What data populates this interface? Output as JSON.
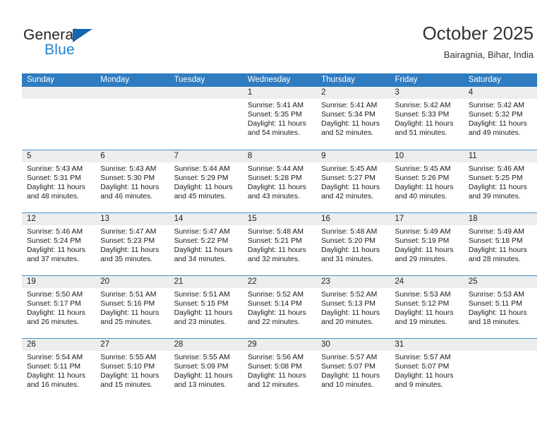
{
  "brand": {
    "name_top": "General",
    "name_bottom": "Blue",
    "accent_color": "#2283d1",
    "triangle_color": "#1666b0"
  },
  "header": {
    "title": "October 2025",
    "subtitle": "Bairagnia, Bihar, India"
  },
  "calendar": {
    "header_color": "#2f7cc0",
    "daynum_band_color": "#ededed",
    "row_divider_color": "#4a90c8",
    "day_names": [
      "Sunday",
      "Monday",
      "Tuesday",
      "Wednesday",
      "Thursday",
      "Friday",
      "Saturday"
    ],
    "weeks": [
      [
        {
          "day": "",
          "empty": true
        },
        {
          "day": "",
          "empty": true
        },
        {
          "day": "",
          "empty": true
        },
        {
          "day": "1",
          "sunrise": "Sunrise: 5:41 AM",
          "sunset": "Sunset: 5:35 PM",
          "daylight_line1": "Daylight: 11 hours",
          "daylight_line2": "and 54 minutes."
        },
        {
          "day": "2",
          "sunrise": "Sunrise: 5:41 AM",
          "sunset": "Sunset: 5:34 PM",
          "daylight_line1": "Daylight: 11 hours",
          "daylight_line2": "and 52 minutes."
        },
        {
          "day": "3",
          "sunrise": "Sunrise: 5:42 AM",
          "sunset": "Sunset: 5:33 PM",
          "daylight_line1": "Daylight: 11 hours",
          "daylight_line2": "and 51 minutes."
        },
        {
          "day": "4",
          "sunrise": "Sunrise: 5:42 AM",
          "sunset": "Sunset: 5:32 PM",
          "daylight_line1": "Daylight: 11 hours",
          "daylight_line2": "and 49 minutes."
        }
      ],
      [
        {
          "day": "5",
          "sunrise": "Sunrise: 5:43 AM",
          "sunset": "Sunset: 5:31 PM",
          "daylight_line1": "Daylight: 11 hours",
          "daylight_line2": "and 48 minutes."
        },
        {
          "day": "6",
          "sunrise": "Sunrise: 5:43 AM",
          "sunset": "Sunset: 5:30 PM",
          "daylight_line1": "Daylight: 11 hours",
          "daylight_line2": "and 46 minutes."
        },
        {
          "day": "7",
          "sunrise": "Sunrise: 5:44 AM",
          "sunset": "Sunset: 5:29 PM",
          "daylight_line1": "Daylight: 11 hours",
          "daylight_line2": "and 45 minutes."
        },
        {
          "day": "8",
          "sunrise": "Sunrise: 5:44 AM",
          "sunset": "Sunset: 5:28 PM",
          "daylight_line1": "Daylight: 11 hours",
          "daylight_line2": "and 43 minutes."
        },
        {
          "day": "9",
          "sunrise": "Sunrise: 5:45 AM",
          "sunset": "Sunset: 5:27 PM",
          "daylight_line1": "Daylight: 11 hours",
          "daylight_line2": "and 42 minutes."
        },
        {
          "day": "10",
          "sunrise": "Sunrise: 5:45 AM",
          "sunset": "Sunset: 5:26 PM",
          "daylight_line1": "Daylight: 11 hours",
          "daylight_line2": "and 40 minutes."
        },
        {
          "day": "11",
          "sunrise": "Sunrise: 5:46 AM",
          "sunset": "Sunset: 5:25 PM",
          "daylight_line1": "Daylight: 11 hours",
          "daylight_line2": "and 39 minutes."
        }
      ],
      [
        {
          "day": "12",
          "sunrise": "Sunrise: 5:46 AM",
          "sunset": "Sunset: 5:24 PM",
          "daylight_line1": "Daylight: 11 hours",
          "daylight_line2": "and 37 minutes."
        },
        {
          "day": "13",
          "sunrise": "Sunrise: 5:47 AM",
          "sunset": "Sunset: 5:23 PM",
          "daylight_line1": "Daylight: 11 hours",
          "daylight_line2": "and 35 minutes."
        },
        {
          "day": "14",
          "sunrise": "Sunrise: 5:47 AM",
          "sunset": "Sunset: 5:22 PM",
          "daylight_line1": "Daylight: 11 hours",
          "daylight_line2": "and 34 minutes."
        },
        {
          "day": "15",
          "sunrise": "Sunrise: 5:48 AM",
          "sunset": "Sunset: 5:21 PM",
          "daylight_line1": "Daylight: 11 hours",
          "daylight_line2": "and 32 minutes."
        },
        {
          "day": "16",
          "sunrise": "Sunrise: 5:48 AM",
          "sunset": "Sunset: 5:20 PM",
          "daylight_line1": "Daylight: 11 hours",
          "daylight_line2": "and 31 minutes."
        },
        {
          "day": "17",
          "sunrise": "Sunrise: 5:49 AM",
          "sunset": "Sunset: 5:19 PM",
          "daylight_line1": "Daylight: 11 hours",
          "daylight_line2": "and 29 minutes."
        },
        {
          "day": "18",
          "sunrise": "Sunrise: 5:49 AM",
          "sunset": "Sunset: 5:18 PM",
          "daylight_line1": "Daylight: 11 hours",
          "daylight_line2": "and 28 minutes."
        }
      ],
      [
        {
          "day": "19",
          "sunrise": "Sunrise: 5:50 AM",
          "sunset": "Sunset: 5:17 PM",
          "daylight_line1": "Daylight: 11 hours",
          "daylight_line2": "and 26 minutes."
        },
        {
          "day": "20",
          "sunrise": "Sunrise: 5:51 AM",
          "sunset": "Sunset: 5:16 PM",
          "daylight_line1": "Daylight: 11 hours",
          "daylight_line2": "and 25 minutes."
        },
        {
          "day": "21",
          "sunrise": "Sunrise: 5:51 AM",
          "sunset": "Sunset: 5:15 PM",
          "daylight_line1": "Daylight: 11 hours",
          "daylight_line2": "and 23 minutes."
        },
        {
          "day": "22",
          "sunrise": "Sunrise: 5:52 AM",
          "sunset": "Sunset: 5:14 PM",
          "daylight_line1": "Daylight: 11 hours",
          "daylight_line2": "and 22 minutes."
        },
        {
          "day": "23",
          "sunrise": "Sunrise: 5:52 AM",
          "sunset": "Sunset: 5:13 PM",
          "daylight_line1": "Daylight: 11 hours",
          "daylight_line2": "and 20 minutes."
        },
        {
          "day": "24",
          "sunrise": "Sunrise: 5:53 AM",
          "sunset": "Sunset: 5:12 PM",
          "daylight_line1": "Daylight: 11 hours",
          "daylight_line2": "and 19 minutes."
        },
        {
          "day": "25",
          "sunrise": "Sunrise: 5:53 AM",
          "sunset": "Sunset: 5:11 PM",
          "daylight_line1": "Daylight: 11 hours",
          "daylight_line2": "and 18 minutes."
        }
      ],
      [
        {
          "day": "26",
          "sunrise": "Sunrise: 5:54 AM",
          "sunset": "Sunset: 5:11 PM",
          "daylight_line1": "Daylight: 11 hours",
          "daylight_line2": "and 16 minutes."
        },
        {
          "day": "27",
          "sunrise": "Sunrise: 5:55 AM",
          "sunset": "Sunset: 5:10 PM",
          "daylight_line1": "Daylight: 11 hours",
          "daylight_line2": "and 15 minutes."
        },
        {
          "day": "28",
          "sunrise": "Sunrise: 5:55 AM",
          "sunset": "Sunset: 5:09 PM",
          "daylight_line1": "Daylight: 11 hours",
          "daylight_line2": "and 13 minutes."
        },
        {
          "day": "29",
          "sunrise": "Sunrise: 5:56 AM",
          "sunset": "Sunset: 5:08 PM",
          "daylight_line1": "Daylight: 11 hours",
          "daylight_line2": "and 12 minutes."
        },
        {
          "day": "30",
          "sunrise": "Sunrise: 5:57 AM",
          "sunset": "Sunset: 5:07 PM",
          "daylight_line1": "Daylight: 11 hours",
          "daylight_line2": "and 10 minutes."
        },
        {
          "day": "31",
          "sunrise": "Sunrise: 5:57 AM",
          "sunset": "Sunset: 5:07 PM",
          "daylight_line1": "Daylight: 11 hours",
          "daylight_line2": "and 9 minutes."
        },
        {
          "day": "",
          "empty": true
        }
      ]
    ]
  }
}
